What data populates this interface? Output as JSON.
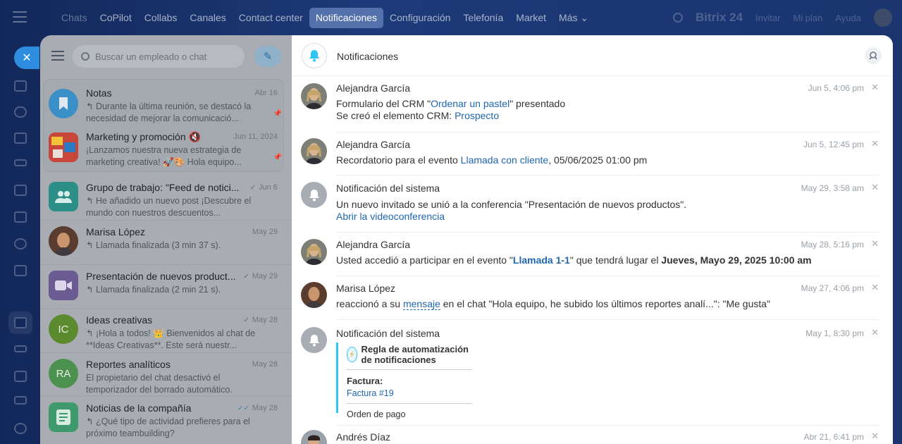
{
  "topnav": {
    "items": [
      {
        "label": "Chats",
        "state": "dim"
      },
      {
        "label": "CoPilot",
        "state": "normal"
      },
      {
        "label": "Collabs",
        "state": "normal"
      },
      {
        "label": "Canales",
        "state": "normal"
      },
      {
        "label": "Contact center",
        "state": "normal"
      },
      {
        "label": "Notificaciones",
        "state": "active"
      },
      {
        "label": "Configuración",
        "state": "normal"
      },
      {
        "label": "Telefonía",
        "state": "normal"
      },
      {
        "label": "Market",
        "state": "normal"
      },
      {
        "label": "Más ⌄",
        "state": "normal"
      }
    ],
    "brand": "Bitrix 24",
    "invite": "Invitar",
    "plan": "Mi plan",
    "help": "Ayuda"
  },
  "chatlist": {
    "search_placeholder": "Buscar un empleado o chat",
    "chats": [
      {
        "title": "Notas",
        "date": "Abr 16",
        "preview": "↰ Durante la última reunión, se destacó la necesidad de mejorar la comunicació...",
        "avatar_color": "#3a8fc6",
        "avatar_text": "",
        "pinned": true,
        "check": ""
      },
      {
        "title": "Marketing y promoción 🔇",
        "date": "Jun 11, 2024",
        "preview": "¡Lanzamos nuestra nueva estrategia de marketing creativa! 🚀🎨 Hola equipo...",
        "avatar_color": "#b7462e",
        "avatar_text": "",
        "pinned": true,
        "check": ""
      },
      {
        "title": "Grupo de trabajo: \"Feed de notici...",
        "date": "Jun 6",
        "preview": "↰ He añadido un nuevo post ¡Descubre el mundo con nuestros descuentos...",
        "avatar_color": "#2b8f88",
        "avatar_text": "",
        "pinned": false,
        "check": "✓"
      },
      {
        "title": "Marisa López",
        "date": "May 29",
        "preview": "↰ Llamada finalizada (3 min 37 s).",
        "avatar_color": "#7a5a48",
        "avatar_text": "",
        "pinned": false,
        "check": ""
      },
      {
        "title": "Presentación de nuevos product...",
        "date": "May 29",
        "preview": "↰ Llamada finalizada (2 min 21 s).",
        "avatar_color": "#6a5b92",
        "avatar_text": "",
        "pinned": false,
        "check": "✓"
      },
      {
        "title": "Ideas creativas",
        "date": "May 28",
        "preview": "↰ ¡Hola a todos! 👑 Bienvenidos al chat de **Ideas Creativas**. Este será nuestr...",
        "avatar_color": "#5c8a2e",
        "avatar_text": "IC",
        "pinned": false,
        "check": "✓"
      },
      {
        "title": "Reportes analíticos",
        "date": "May 28",
        "preview": "El propietario del chat desactivó el temporizador del borrado automático.",
        "avatar_color": "#4d9150",
        "avatar_text": "RA",
        "pinned": false,
        "check": ""
      },
      {
        "title": "Noticias de la compañía",
        "date": "May 28",
        "preview": "↰ ¿Qué tipo de actividad prefieres para el próximo teambuilding?",
        "avatar_color": "#3e9a6c",
        "avatar_text": "",
        "pinned": false,
        "check": "✓✓"
      }
    ]
  },
  "notifications": {
    "title": "Notificaciones",
    "items": [
      {
        "author": "Alejandra García",
        "date": "Jun 5, 4:06 pm",
        "avatar": "woman-blonde",
        "line1": {
          "pre": "Formulario del CRM \"",
          "link": "Ordenar un pastel",
          "post": "\" presentado"
        },
        "line2": {
          "pre": "Se creó el elemento CRM: ",
          "link": "Prospecto",
          "post": ""
        }
      },
      {
        "author": "Alejandra García",
        "date": "Jun 5, 12:45 pm",
        "avatar": "woman-blonde",
        "line1": {
          "pre": "Recordatorio para el evento ",
          "link": "Llamada con cliente",
          "post": ", 05/06/2025 01:00 pm"
        }
      },
      {
        "author": "Notificación del sistema",
        "date": "May 29, 3:58 am",
        "avatar": "system",
        "line1": {
          "pre": "Un nuevo invitado se unió a la conferencia \"Presentación de nuevos productos\".",
          "link": "",
          "post": ""
        },
        "line2": {
          "pre": "",
          "link": "Abrir la videoconferencia",
          "post": ""
        }
      },
      {
        "author": "Alejandra García",
        "date": "May 28, 5:16 pm",
        "avatar": "woman-blonde",
        "line1": {
          "pre": "Usted accedió a participar en el evento \"",
          "link": "Llamada 1-1",
          "mid": "\" que tendrá lugar el ",
          "bold": "Jueves, Mayo 29, 2025 10:00 am"
        }
      },
      {
        "author": "Marisa López",
        "date": "May 27, 4:06 pm",
        "avatar": "woman-brunette",
        "line1": {
          "pre": "reaccionó a su ",
          "link": "mensaje",
          "post": " en el chat \"Hola equipo, he subido los últimos reportes analí...\": \"Me gusta\""
        }
      },
      {
        "author": "Notificación del sistema",
        "date": "May 1, 8:30 pm",
        "avatar": "system",
        "rule": {
          "title": "Regla de automatización de notificaciones",
          "label": "Factura:",
          "link": "Factura #19",
          "footer": "Orden de pago"
        }
      },
      {
        "author": "Andrés Díaz",
        "date": "Abr 21, 6:41 pm",
        "avatar": "man"
      }
    ]
  },
  "colors": {
    "accent": "#2067b0",
    "active_tab": "#2f8de0",
    "rule_border": "#2fc6f6"
  }
}
